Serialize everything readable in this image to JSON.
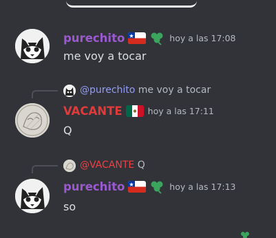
{
  "messages": [
    {
      "username": "purechito",
      "username_color": "#9b59d0",
      "flag": "chile-flag",
      "badge": "clover-icon",
      "timestamp": "hoy a las 17:08",
      "text": "me voy a tocar"
    },
    {
      "reply": {
        "mention": "@purechito",
        "text": "me voy a tocar"
      },
      "username": "VACANTE",
      "username_color": "#e03b3b",
      "flag": "mexico-flag",
      "timestamp": "hoy a las 17:11",
      "text": "Q"
    },
    {
      "reply": {
        "mention": "@VACANTE",
        "text": "Q"
      },
      "username": "purechito",
      "username_color": "#9b59d0",
      "flag": "chile-flag",
      "badge": "clover-icon",
      "timestamp": "hoy a las 17:13",
      "text": "so"
    }
  ],
  "colors": {
    "background": "#313338",
    "text": "#dbdee1",
    "muted": "#b5bac1",
    "mention_blue": "#949cf7",
    "mention_red": "#f23f42",
    "clover_green": "#3ba55d"
  }
}
